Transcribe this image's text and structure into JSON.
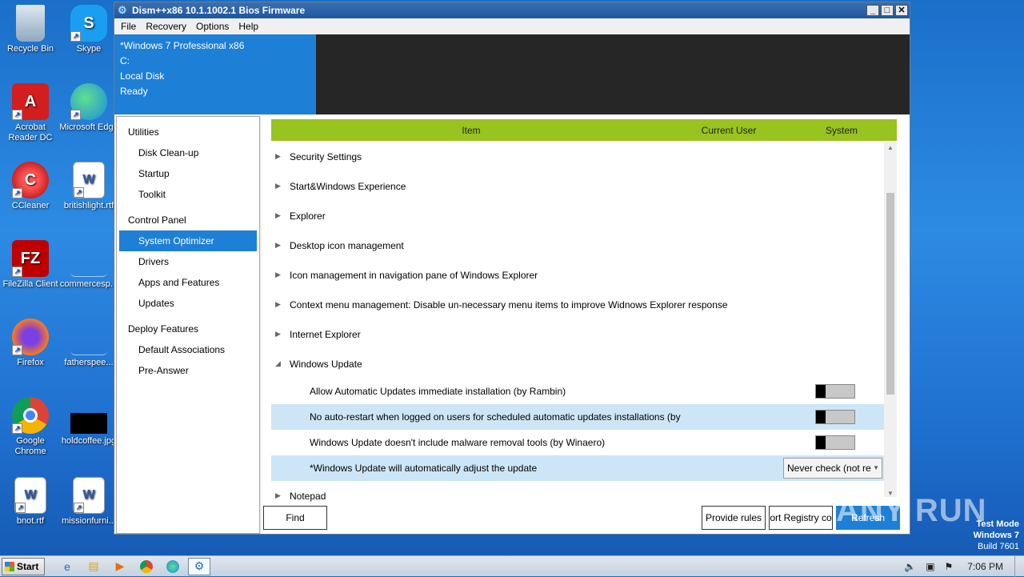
{
  "desktop": {
    "icons": [
      {
        "label": "Recycle Bin"
      },
      {
        "label": "Skype"
      },
      {
        "label": "Acrobat Reader DC"
      },
      {
        "label": "Microsoft Edge"
      },
      {
        "label": "CCleaner"
      },
      {
        "label": "britishlight.rtf"
      },
      {
        "label": "FileZilla Client"
      },
      {
        "label": "commercesp..."
      },
      {
        "label": "Firefox"
      },
      {
        "label": "fatherspee..."
      },
      {
        "label": "Google Chrome"
      },
      {
        "label": "holdcoffee.jpg"
      },
      {
        "label": "bnot.rtf"
      },
      {
        "label": "missionfurni..."
      }
    ]
  },
  "window": {
    "title": "Dism++x86 10.1.1002.1 Bios Firmware",
    "menu": [
      "File",
      "Recovery",
      "Options",
      "Help"
    ],
    "info": {
      "os": "*Windows 7 Professional x86",
      "drive": "C:",
      "disk": "Local Disk",
      "status": "Ready"
    }
  },
  "nav": {
    "sections": [
      {
        "header": "Utilities",
        "items": [
          "Disk Clean-up",
          "Startup",
          "Toolkit"
        ]
      },
      {
        "header": "Control Panel",
        "items": [
          "System Optimizer",
          "Drivers",
          "Apps and Features",
          "Updates"
        ]
      },
      {
        "header": "Deploy Features",
        "items": [
          "Default Associations",
          "Pre-Answer"
        ]
      }
    ],
    "selected": "System Optimizer"
  },
  "grid": {
    "columns": {
      "item": "Item",
      "user": "Current User",
      "system": "System"
    },
    "categories": [
      "Security Settings",
      "Start&Windows Experience",
      "Explorer",
      "Desktop icon management",
      "Icon management in navigation pane of Windows Explorer",
      "Context menu management: Disable un-necessary menu items to improve Widnows Explorer response",
      "Internet Explorer",
      "Windows Update"
    ],
    "windows_update": [
      {
        "label": "Allow Automatic Updates immediate installation (by Rambin)"
      },
      {
        "label": "No auto-restart when logged on users for scheduled automatic updates installations (by"
      },
      {
        "label": "Windows Update doesn't include malware removal tools (by Winaero)"
      },
      {
        "label": "*Windows Update will automatically adjust the update",
        "value": "Never check (not re"
      }
    ],
    "after": "Notepad"
  },
  "buttons": {
    "find": "Find",
    "provide_rules": "Provide rules",
    "export_registry": "ort Registry co",
    "refresh": "Refresh"
  },
  "taskbar": {
    "start": "Start",
    "clock": "7:06 PM"
  },
  "watermark": {
    "line1": "Test Mode",
    "line2": "Windows 7",
    "line3": "Build 7601",
    "brand": "ANY RUN"
  }
}
